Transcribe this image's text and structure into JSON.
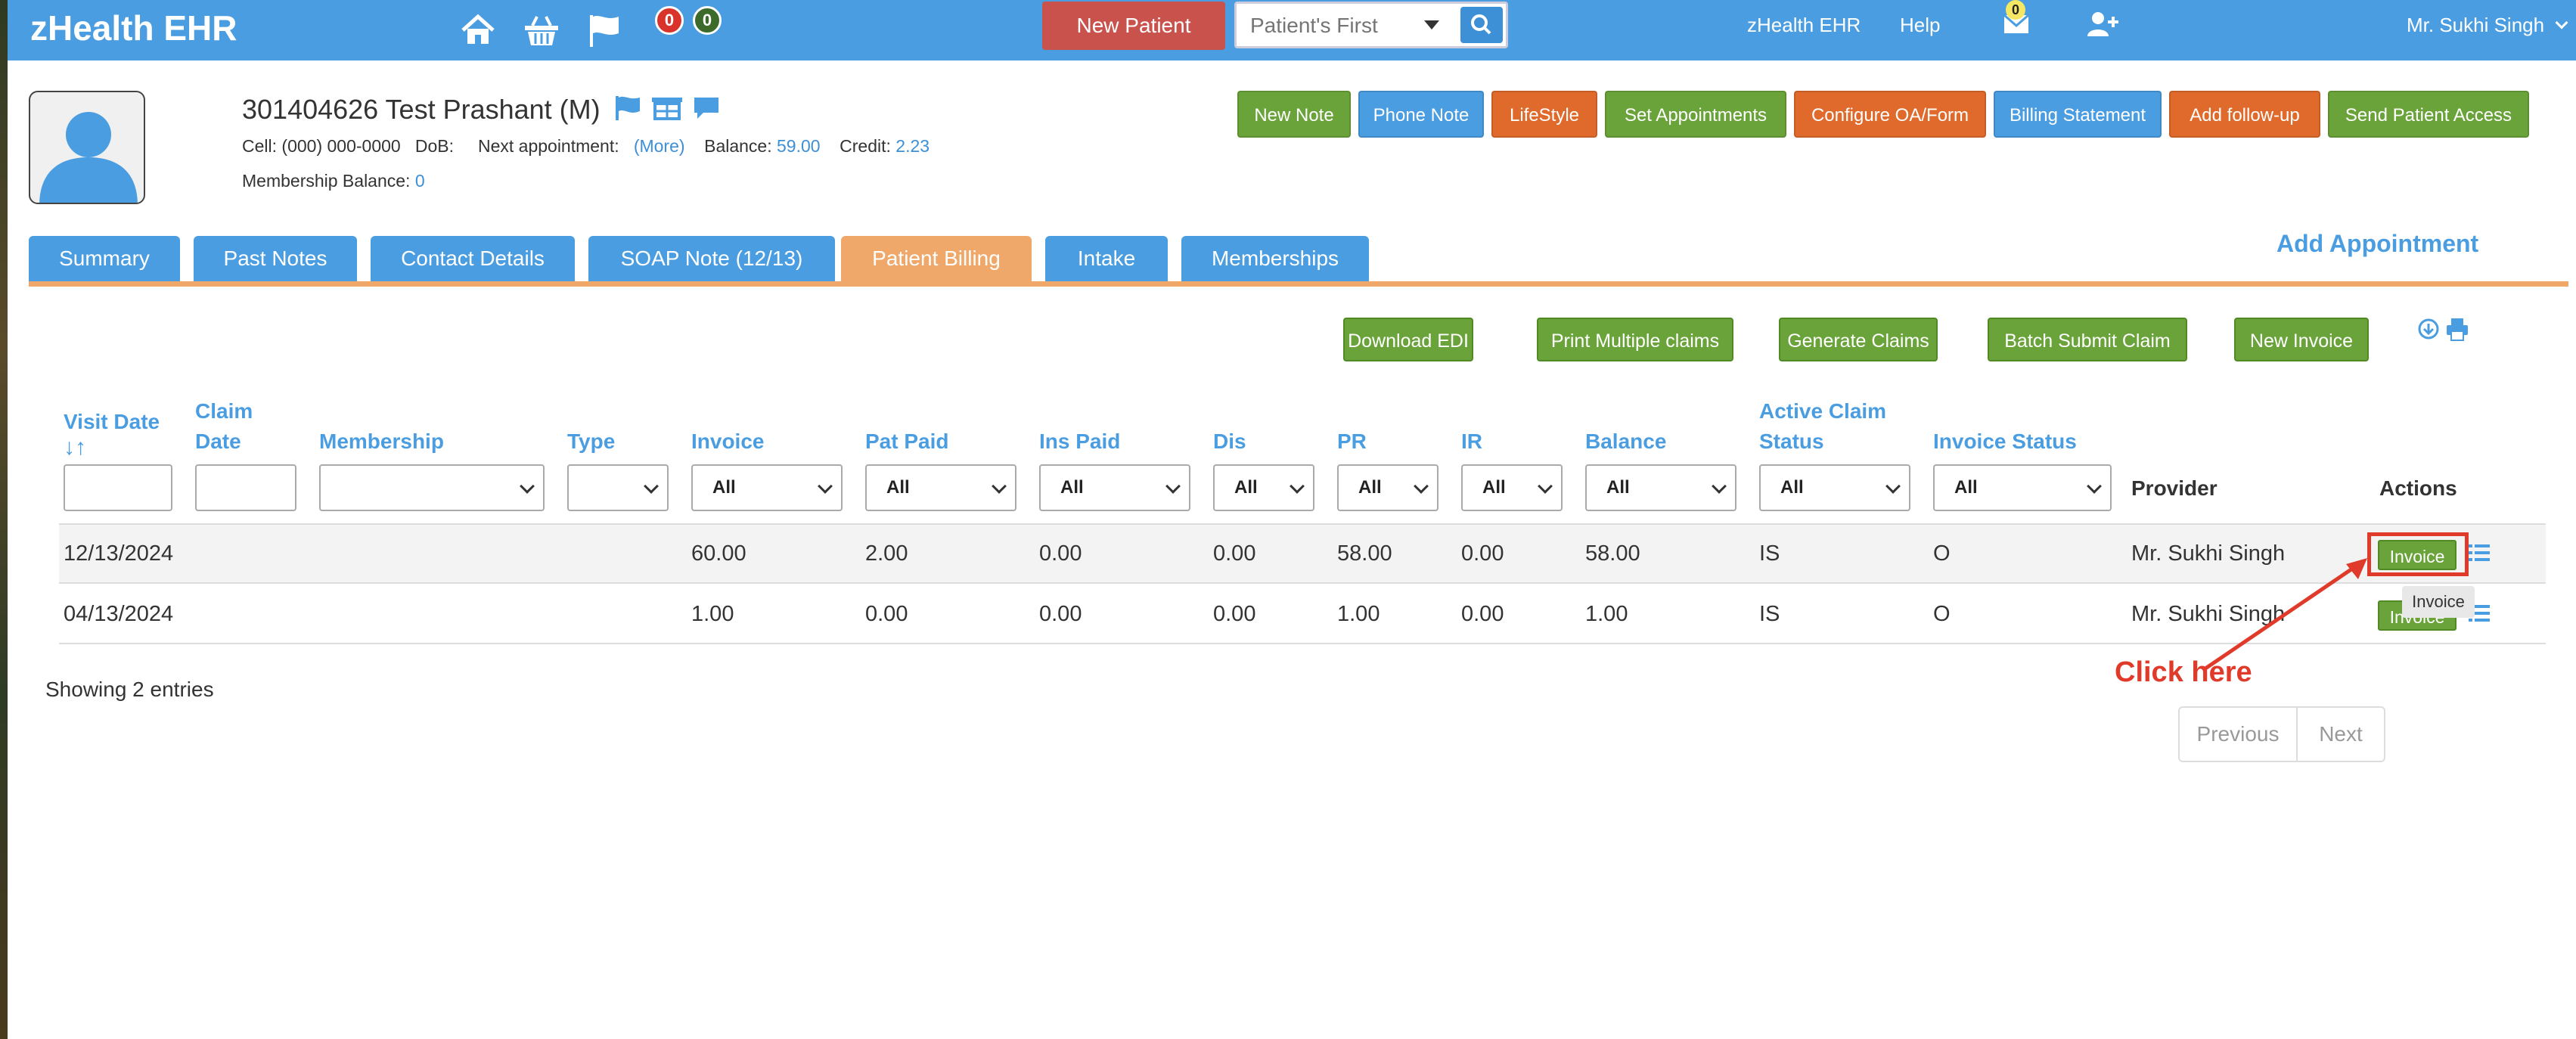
{
  "app": {
    "brand": "zHealth EHR"
  },
  "topbar": {
    "badge_red": "0",
    "badge_green": "0",
    "new_patient_label": "New Patient",
    "search_placeholder": "Patient's First",
    "ehr_link": "zHealth EHR",
    "help_link": "Help",
    "mail_count": "0",
    "user_name": "Mr. Sukhi Singh"
  },
  "patient": {
    "name": "301404626 Test Prashant (M)",
    "cell_label": "Cell:",
    "cell_value": "(000) 000-0000",
    "dob_label": "DoB:",
    "next_appt_label": "Next appointment:",
    "next_appt_more": "(More)",
    "balance_label": "Balance:",
    "balance_value": "59.00",
    "credit_label": "Credit:",
    "credit_value": "2.23",
    "membership_balance_label": "Membership Balance:",
    "membership_balance_value": "0"
  },
  "patient_buttons": {
    "new_note": "New Note",
    "phone_note": "Phone Note",
    "lifestyle": "LifeStyle",
    "set_appointments": "Set Appointments",
    "configure_oa": "Configure OA/Form",
    "billing_statement": "Billing Statement",
    "add_followup": "Add follow-up",
    "send_access": "Send Patient Access"
  },
  "tabs": {
    "summary": "Summary",
    "past_notes": "Past Notes",
    "contact_details": "Contact Details",
    "soap_note": "SOAP Note (12/13)",
    "patient_billing": "Patient Billing",
    "intake": "Intake",
    "memberships": "Memberships",
    "active": "Patient Billing"
  },
  "add_appointment": "Add Appointment",
  "billing_actions": {
    "download_edi": "Download EDI",
    "print_multiple": "Print Multiple claims",
    "generate_claims": "Generate Claims",
    "batch_submit": "Batch Submit Claim",
    "new_invoice": "New Invoice"
  },
  "table": {
    "headers": {
      "visit_date": "Visit Date",
      "claim_date_1": "Claim",
      "claim_date_2": "Date",
      "membership": "Membership",
      "type": "Type",
      "invoice": "Invoice",
      "pat_paid": "Pat Paid",
      "ins_paid": "Ins Paid",
      "dis": "Dis",
      "pr": "PR",
      "ir": "IR",
      "balance": "Balance",
      "active_claim_1": "Active Claim",
      "active_claim_2": "Status",
      "invoice_status": "Invoice Status",
      "provider": "Provider",
      "actions": "Actions"
    },
    "filter_all": "All",
    "rows": [
      {
        "visit_date": "12/13/2024",
        "invoice": "60.00",
        "pat_paid": "2.00",
        "ins_paid": "0.00",
        "dis": "0.00",
        "pr": "58.00",
        "ir": "0.00",
        "balance": "58.00",
        "claim_status": "IS",
        "invoice_status": "O",
        "provider": "Mr. Sukhi Singh",
        "action": "Invoice"
      },
      {
        "visit_date": "04/13/2024",
        "invoice": "1.00",
        "pat_paid": "0.00",
        "ins_paid": "0.00",
        "dis": "0.00",
        "pr": "1.00",
        "ir": "0.00",
        "balance": "1.00",
        "claim_status": "IS",
        "invoice_status": "O",
        "provider": "Mr. Sukhi Singh",
        "action": "Invoice"
      }
    ],
    "showing": "Showing 2 entries"
  },
  "annotation": {
    "tooltip": "Invoice",
    "click_here": "Click here"
  },
  "pagination": {
    "previous": "Previous",
    "next": "Next"
  },
  "colors": {
    "topbar": "#4a9de0",
    "green": "#6aa33a",
    "orange": "#e06a2c",
    "active_tab": "#efa86a",
    "annotation": "#e03a2a"
  }
}
